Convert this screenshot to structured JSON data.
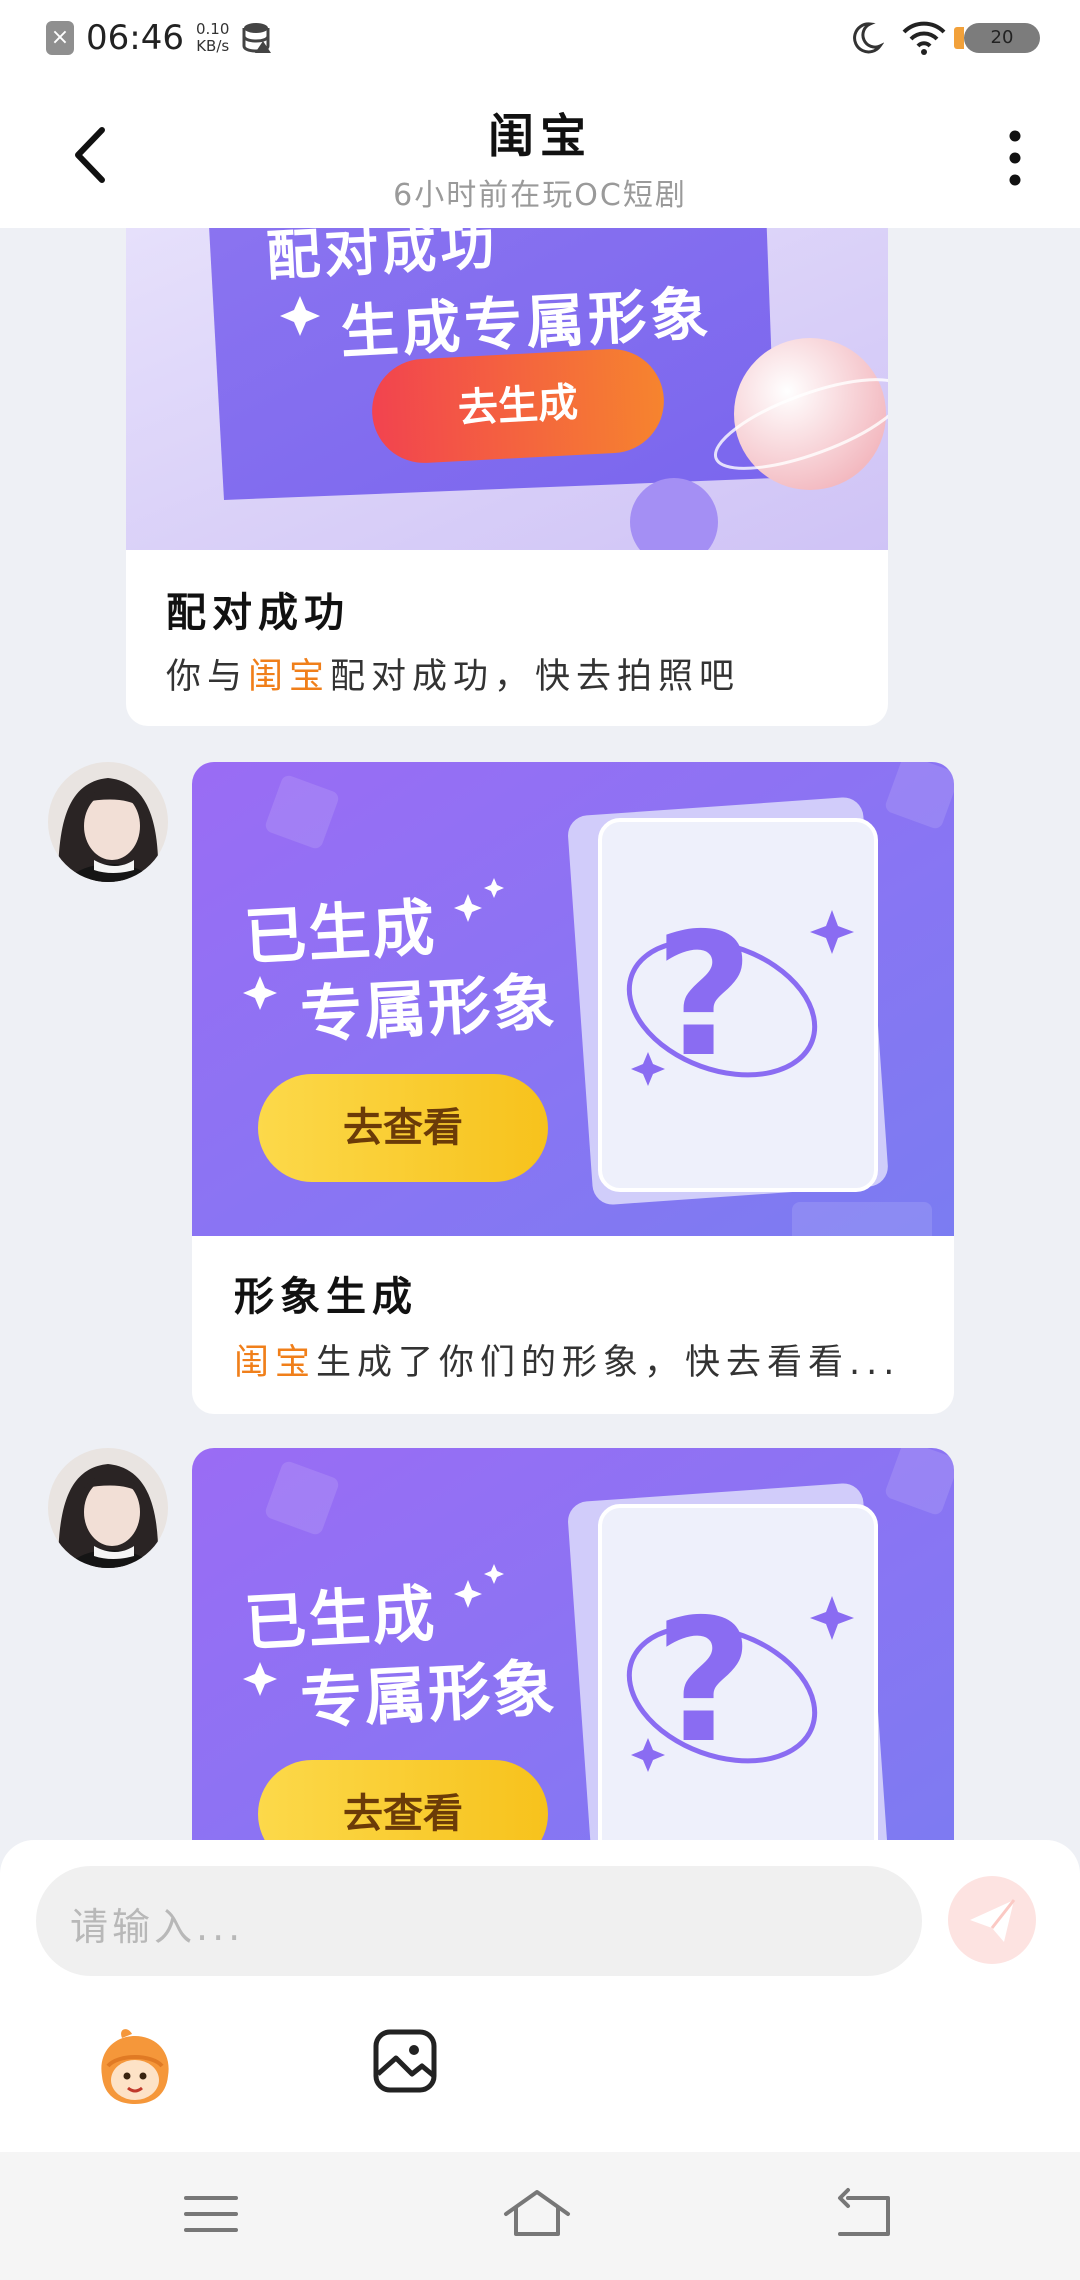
{
  "status_bar": {
    "time": "06:46",
    "net_speed_value": "0.10",
    "net_speed_unit": "KB/s",
    "battery": "20"
  },
  "header": {
    "title": "闺宝",
    "subtitle": "6小时前在玩OC短剧"
  },
  "messages": [
    {
      "banner_line1": "配对成功",
      "banner_line2": "生成专属形象",
      "banner_button": "去生成",
      "title": "配对成功",
      "desc_prefix": "你与",
      "desc_name": "闺宝",
      "desc_suffix": "配对成功，快去拍照吧"
    },
    {
      "banner_line1": "已生成",
      "banner_line2": "专属形象",
      "banner_button": "去查看",
      "title": "形象生成",
      "desc_name": "闺宝",
      "desc_suffix": "生成了你们的形象，快去看看..."
    },
    {
      "banner_line1": "已生成",
      "banner_line2": "专属形象",
      "banner_button": "去查看"
    }
  ],
  "input": {
    "placeholder": "请输入..."
  },
  "icons": {
    "back": "chevron-left-icon",
    "more": "more-vertical-icon",
    "send": "send-icon",
    "mascot": "mascot-icon",
    "image": "image-icon",
    "menu": "menu-icon",
    "home": "home-icon",
    "back_nav": "back-icon"
  },
  "colors": {
    "accent_orange": "#f07f1a",
    "banner_purple": "#8a6cf2",
    "button_yellow": "#fcd23a",
    "button_red": "#f2554b"
  }
}
